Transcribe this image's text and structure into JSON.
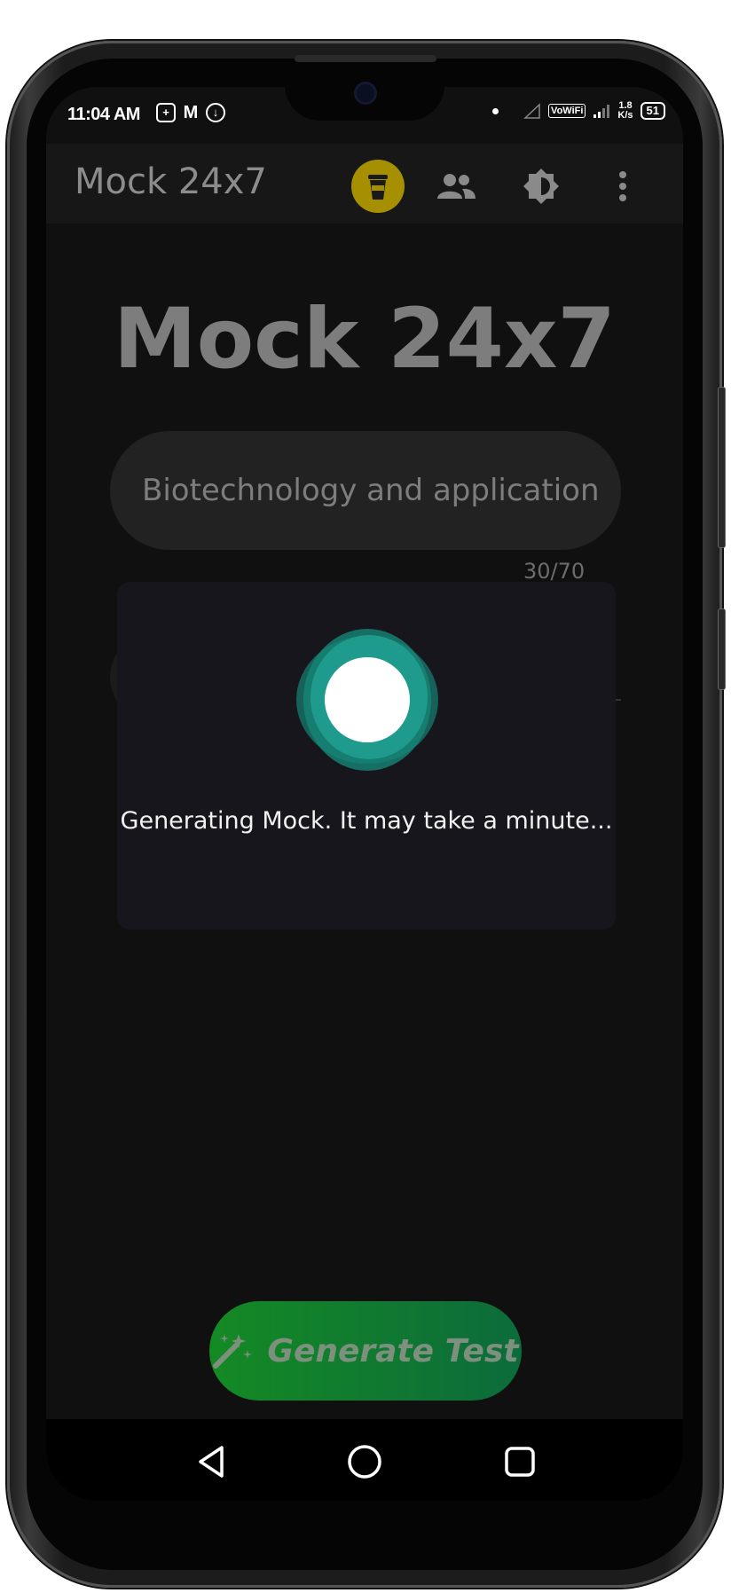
{
  "status_bar": {
    "time": "11:04 AM",
    "vowifi": "VoWiFi",
    "speed_value": "1.8",
    "speed_unit": "K/s",
    "battery": "51"
  },
  "app_bar": {
    "title": "Mock 24x7",
    "icons": [
      "coffee-icon",
      "group-icon",
      "brightness-icon",
      "more-vert-icon"
    ],
    "coffee_button_color": "#a68f00"
  },
  "main": {
    "hero_title": "Mock 24x7",
    "topic_input_value": "Biotechnology and application",
    "char_counter": "30/70"
  },
  "dialog": {
    "message": "Generating Mock. It may take a minute...",
    "spinner_color": "#1f9e8f"
  },
  "generate_button": {
    "label": "Generate Test",
    "icon": "magic-wand-icon"
  },
  "nav_bar": {
    "icons": [
      "back-icon",
      "home-icon",
      "recents-icon"
    ]
  }
}
